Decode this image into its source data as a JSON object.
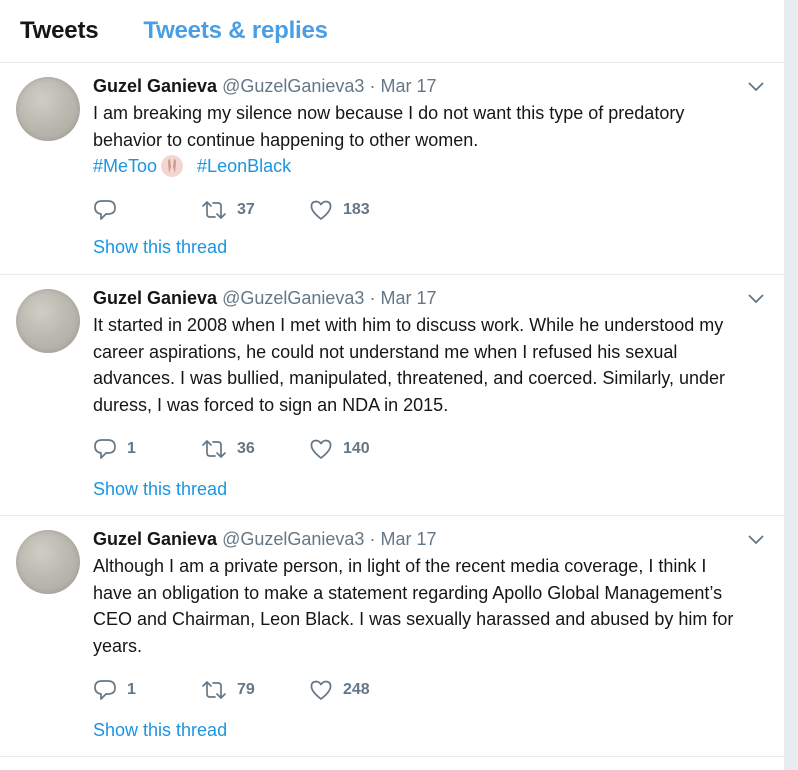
{
  "tabs": {
    "tweets": "Tweets",
    "replies": "Tweets & replies"
  },
  "tweets": [
    {
      "name": "Guzel Ganieva",
      "handle": "@GuzelGanieva3",
      "separator": "·",
      "date": "Mar 17",
      "lines": [
        "I am breaking my silence now because I do not want this type of predatory",
        "behavior to continue happening to other women."
      ],
      "hashtags": [
        "#MeToo",
        "#LeonBlack"
      ],
      "replies": "",
      "retweets": "37",
      "likes": "183",
      "show_thread": "Show this thread"
    },
    {
      "name": "Guzel Ganieva",
      "handle": "@GuzelGanieva3",
      "separator": "·",
      "date": "Mar 17",
      "lines": [
        "It started in 2008 when I met with him to discuss work. While he understood my",
        "career aspirations, he could not understand me when I refused his sexual",
        "advances. I was bullied, manipulated, threatened, and coerced. Similarly, under",
        "duress, I was forced to sign an NDA in 2015."
      ],
      "replies": "1",
      "retweets": "36",
      "likes": "140",
      "show_thread": "Show this thread"
    },
    {
      "name": "Guzel Ganieva",
      "handle": "@GuzelGanieva3",
      "separator": "·",
      "date": "Mar 17",
      "lines": [
        "Although I am a private person, in light of the recent media coverage, I think I",
        "have an obligation to make a statement regarding Apollo Global Management’s",
        "CEO and Chairman, Leon Black. I was sexually harassed and abused by him for",
        "years."
      ],
      "replies": "1",
      "retweets": "79",
      "likes": "248",
      "show_thread": "Show this thread"
    }
  ],
  "icons": {
    "reply": "reply-icon",
    "retweet": "retweet-icon",
    "like": "heart-icon",
    "caret": "chevron-down-icon"
  },
  "colors": {
    "link": "#1b95e0",
    "tab_inactive": "#4a9ee6",
    "muted": "#657786",
    "text": "#14171a"
  }
}
